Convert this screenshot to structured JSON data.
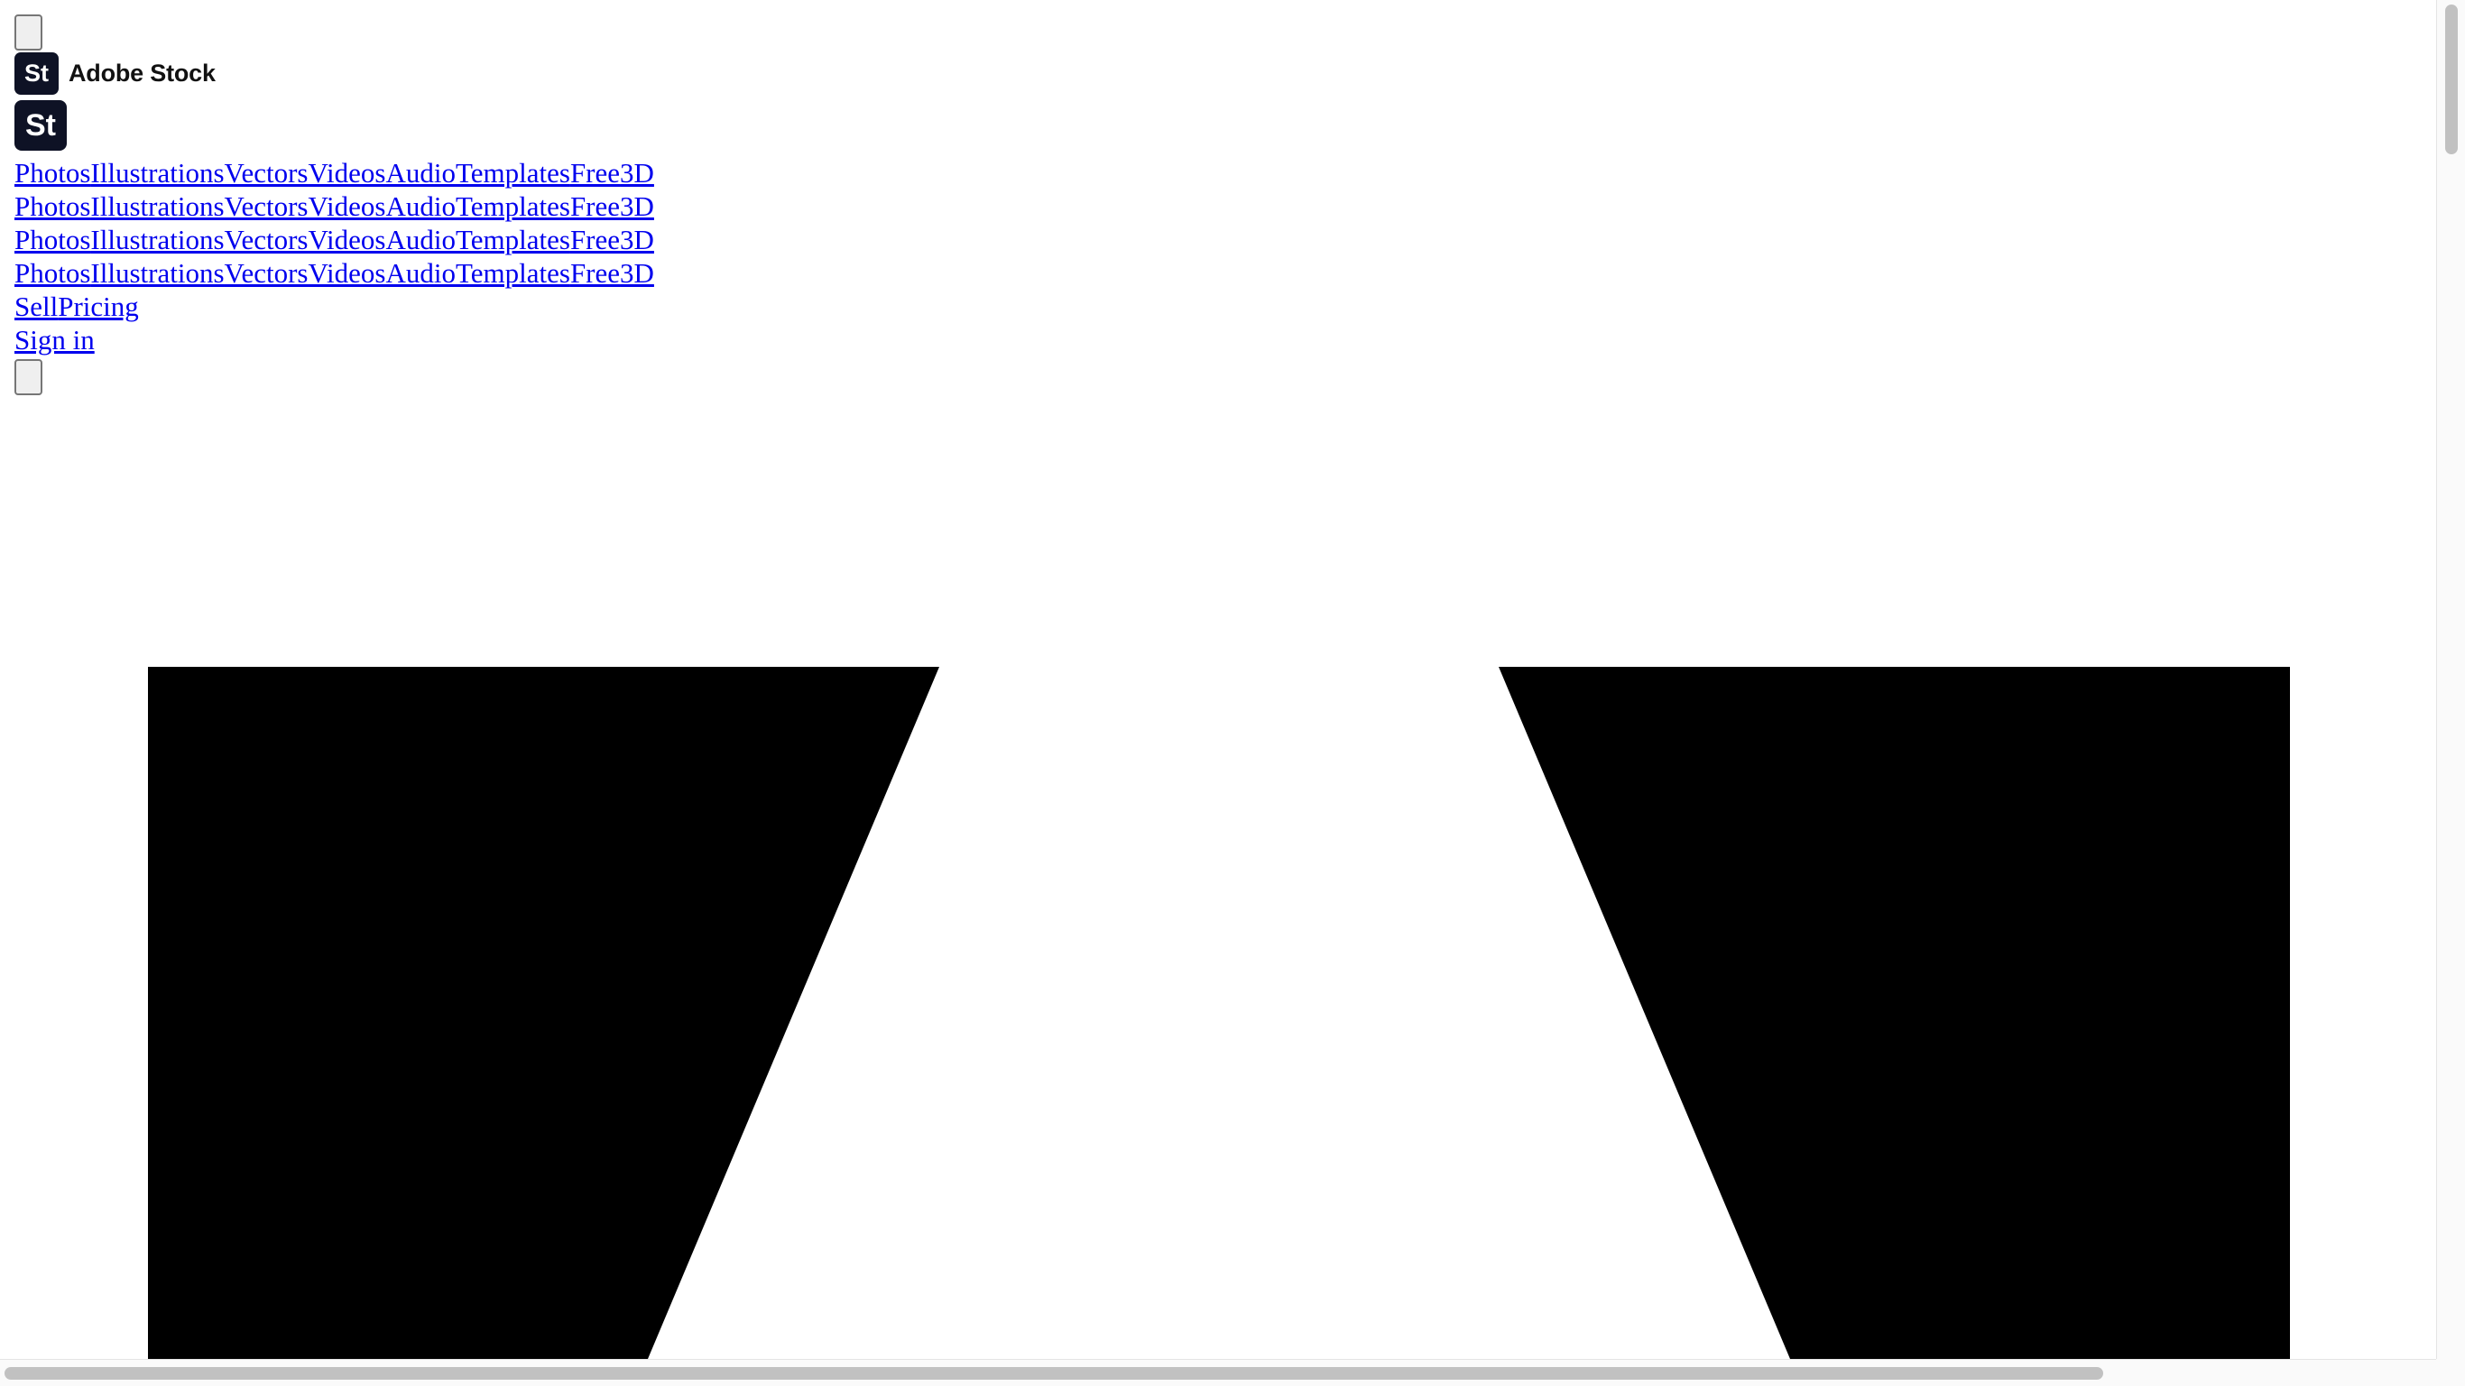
{
  "header": {
    "brand_logo_text": "St",
    "brand_name": "Adobe Stock",
    "logo_text": "St"
  },
  "nav": {
    "content_types": [
      "Photos",
      "Illustrations",
      "Vectors",
      "Videos",
      "Audio",
      "Templates",
      "Free",
      "3D"
    ],
    "rows": 4,
    "secondary": [
      "Sell",
      "Pricing"
    ],
    "sign_in": "Sign in"
  }
}
